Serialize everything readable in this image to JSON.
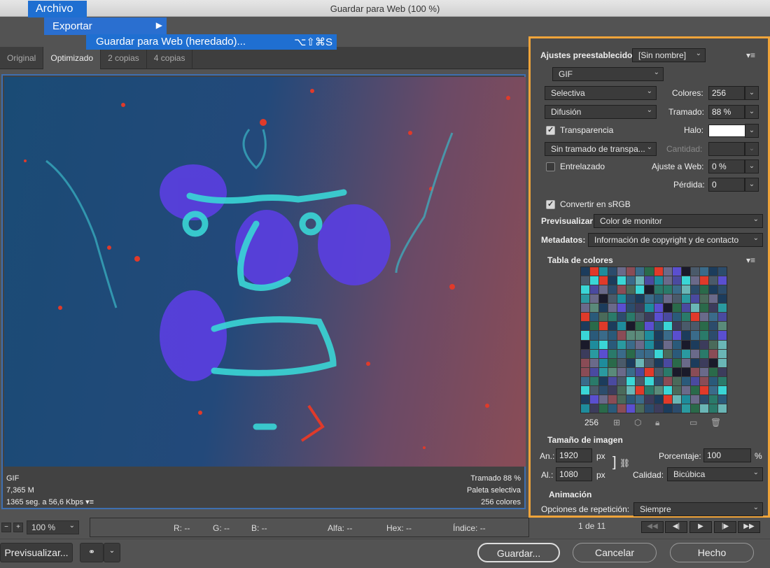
{
  "window": {
    "title": "Guardar para Web (100 %)"
  },
  "menu": {
    "archivo": "Archivo",
    "exportar": "Exportar",
    "exportar_arrow": "▶",
    "guardar_web": "Guardar para Web (heredado)...",
    "guardar_shortcut": "⌥⇧⌘S"
  },
  "tabs": [
    {
      "label": "Original"
    },
    {
      "label": "Optimizado"
    },
    {
      "label": "2 copias"
    },
    {
      "label": "4 copias"
    }
  ],
  "preview_info": {
    "format": "GIF",
    "size": "7,365 M",
    "time": "1365 seg. a 56,6 Kbps",
    "dither": "Tramado 88 %",
    "palette": "Paleta selectiva",
    "colors": "256 colores"
  },
  "panel": {
    "presets_label": "Ajustes preestablecidos:",
    "presets_value": "[Sin nombre]",
    "format_value": "GIF",
    "reduction_value": "Selectiva",
    "colors_label": "Colores:",
    "colors_value": "256",
    "dither_algo_value": "Difusión",
    "dither_label": "Tramado:",
    "dither_value": "88 %",
    "transparency_label": "Transparencia",
    "matte_label": "Halo:",
    "transparency_dither_value": "Sin tramado de transpa...",
    "amount_label": "Cantidad:",
    "interlaced_label": "Entrelazado",
    "web_snap_label": "Ajuste a Web:",
    "web_snap_value": "0 %",
    "lossy_label": "Pérdida:",
    "lossy_value": "0",
    "srgb_label": "Convertir en sRGB",
    "preview_label": "Previsualizar:",
    "preview_value": "Color de monitor",
    "metadata_label": "Metadatos:",
    "metadata_value": "Información de copyright y de contacto",
    "color_table_label": "Tabla de colores",
    "color_count": "256",
    "image_size_label": "Tamaño de imagen",
    "width_label": "An.:",
    "width_value": "1920",
    "height_label": "Al.:",
    "height_value": "1080",
    "px": "px",
    "percent_label": "Porcentaje:",
    "percent_value": "100",
    "percent_sign": "%",
    "quality_label": "Calidad:",
    "quality_value": "Bicúbica",
    "animation_label": "Animación",
    "loop_label": "Opciones de repetición:",
    "loop_value": "Siempre"
  },
  "status": {
    "zoom": "100 %",
    "r": "R: --",
    "g": "G: --",
    "b": "B: --",
    "alpha": "Alfa: --",
    "hex": "Hex: --",
    "index": "Índice: --",
    "frame": "1 de 11"
  },
  "buttons": {
    "preview": "Previsualizar...",
    "save": "Guardar...",
    "cancel": "Cancelar",
    "done": "Hecho"
  },
  "colors": {
    "accent": "#f0a43a",
    "menu_blue": "#1f6fd1",
    "panel_bg": "#4b4b4b"
  }
}
